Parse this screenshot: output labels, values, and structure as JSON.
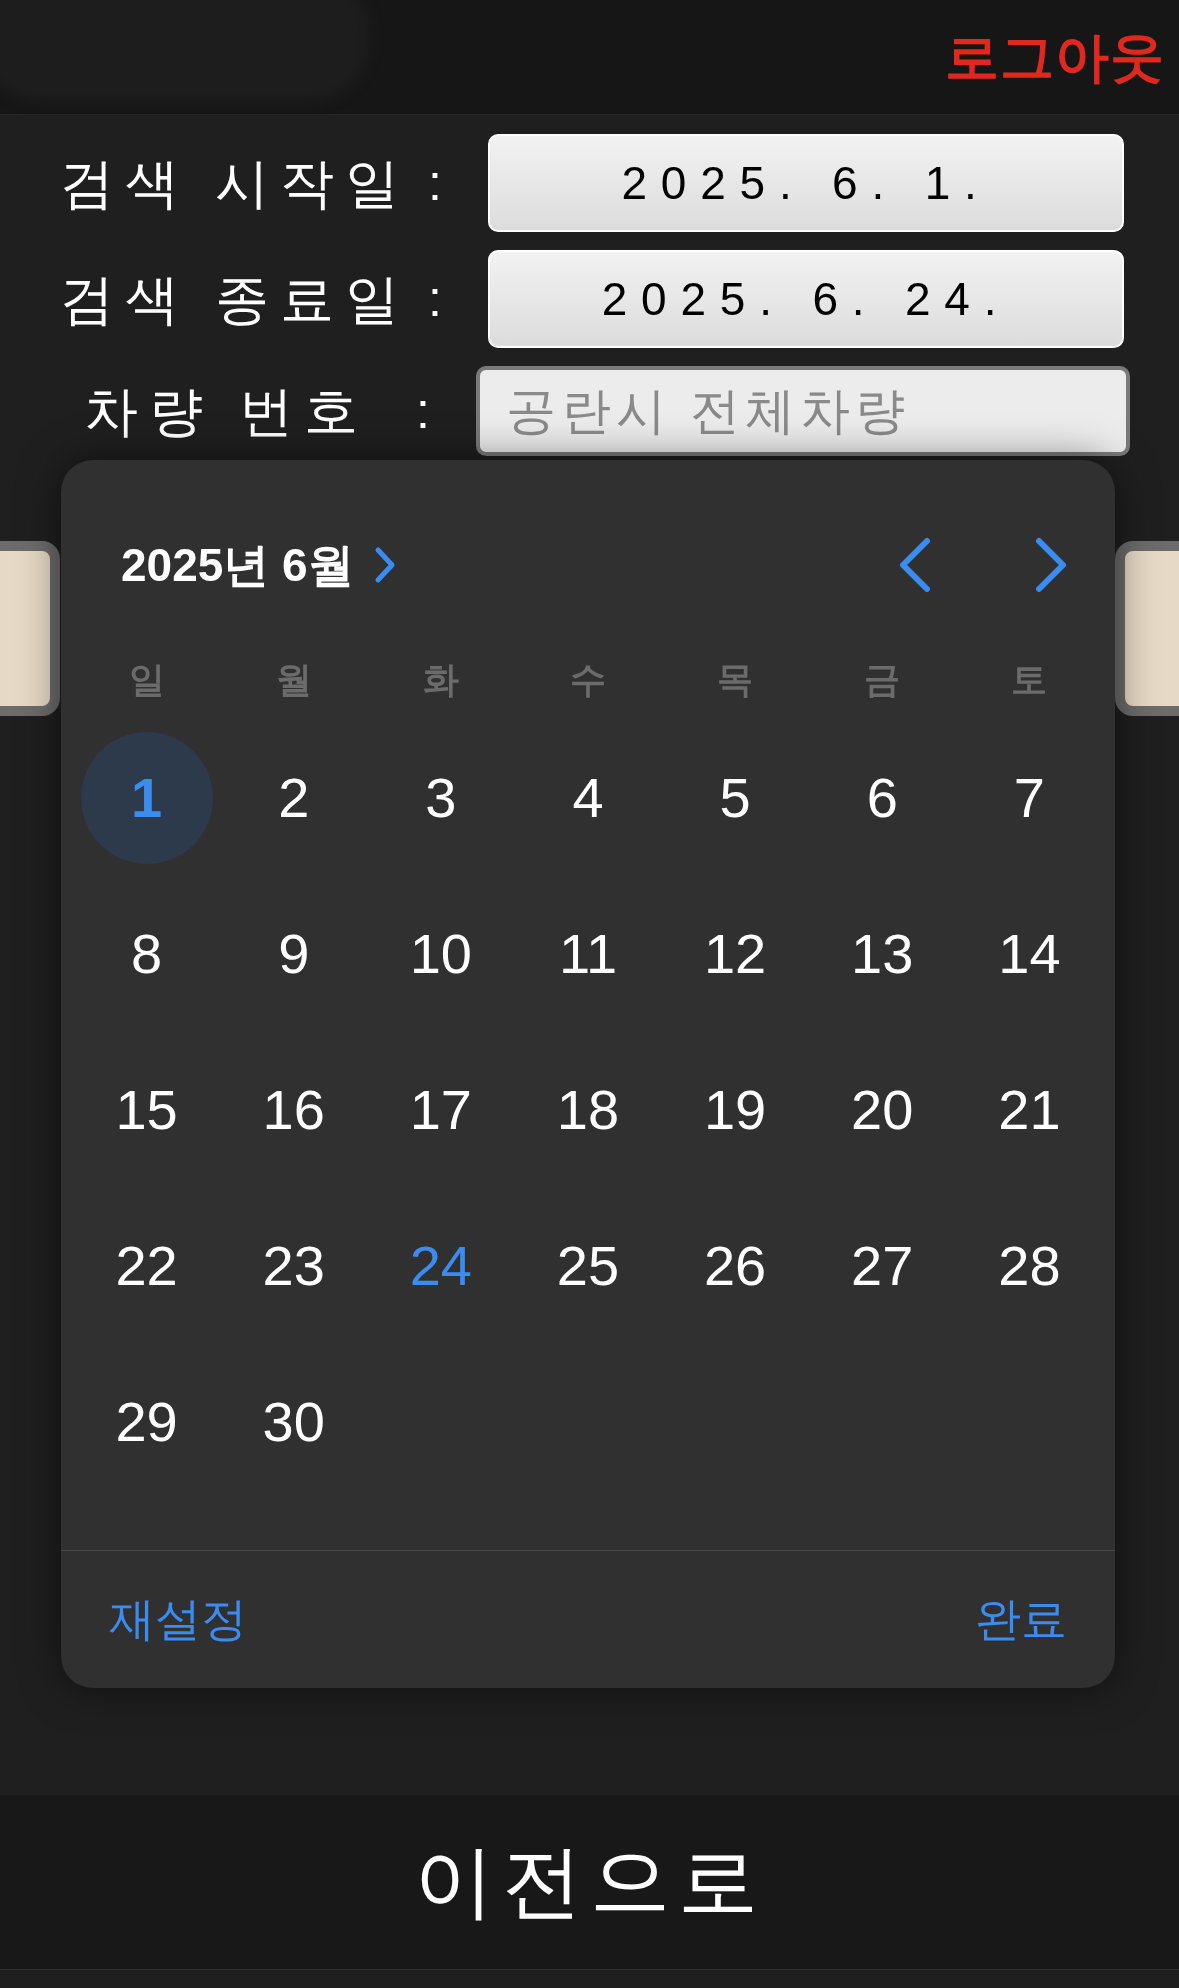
{
  "header": {
    "logout": "로그아웃"
  },
  "form": {
    "rows": [
      {
        "label": "검색 시작일",
        "colon": ":",
        "value": "2025. 6. 1.",
        "kind": "date"
      },
      {
        "label": "검색 종료일",
        "colon": ":",
        "value": "2025. 6. 24.",
        "kind": "date"
      },
      {
        "label": "차량 번호",
        "colon": ":",
        "placeholder": "공란시 전체차량",
        "kind": "text"
      }
    ]
  },
  "calendar": {
    "title": "2025년 6월",
    "weekdays": [
      "일",
      "월",
      "화",
      "수",
      "목",
      "금",
      "토"
    ],
    "days": [
      {
        "label": "1",
        "selected": true,
        "today": false
      },
      {
        "label": "2",
        "selected": false,
        "today": false
      },
      {
        "label": "3",
        "selected": false,
        "today": false
      },
      {
        "label": "4",
        "selected": false,
        "today": false
      },
      {
        "label": "5",
        "selected": false,
        "today": false
      },
      {
        "label": "6",
        "selected": false,
        "today": false
      },
      {
        "label": "7",
        "selected": false,
        "today": false
      },
      {
        "label": "8",
        "selected": false,
        "today": false
      },
      {
        "label": "9",
        "selected": false,
        "today": false
      },
      {
        "label": "10",
        "selected": false,
        "today": false
      },
      {
        "label": "11",
        "selected": false,
        "today": false
      },
      {
        "label": "12",
        "selected": false,
        "today": false
      },
      {
        "label": "13",
        "selected": false,
        "today": false
      },
      {
        "label": "14",
        "selected": false,
        "today": false
      },
      {
        "label": "15",
        "selected": false,
        "today": false
      },
      {
        "label": "16",
        "selected": false,
        "today": false
      },
      {
        "label": "17",
        "selected": false,
        "today": false
      },
      {
        "label": "18",
        "selected": false,
        "today": false
      },
      {
        "label": "19",
        "selected": false,
        "today": false
      },
      {
        "label": "20",
        "selected": false,
        "today": false
      },
      {
        "label": "21",
        "selected": false,
        "today": false
      },
      {
        "label": "22",
        "selected": false,
        "today": false
      },
      {
        "label": "23",
        "selected": false,
        "today": false
      },
      {
        "label": "24",
        "selected": false,
        "today": true
      },
      {
        "label": "25",
        "selected": false,
        "today": false
      },
      {
        "label": "26",
        "selected": false,
        "today": false
      },
      {
        "label": "27",
        "selected": false,
        "today": false
      },
      {
        "label": "28",
        "selected": false,
        "today": false
      },
      {
        "label": "29",
        "selected": false,
        "today": false
      },
      {
        "label": "30",
        "selected": false,
        "today": false
      }
    ],
    "reset": "재설정",
    "done": "완료"
  },
  "footer": {
    "back": "이전으로"
  }
}
